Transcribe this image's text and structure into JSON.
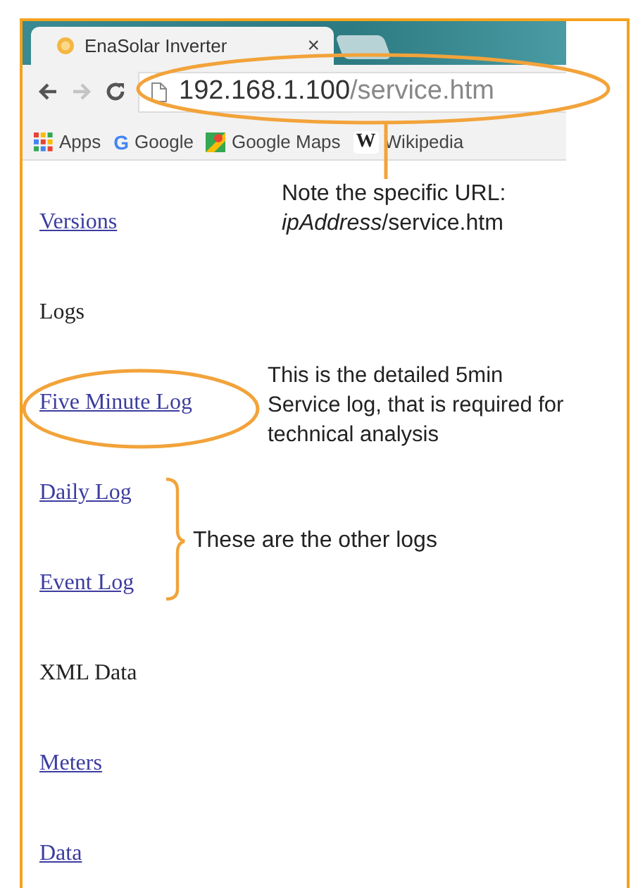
{
  "browser": {
    "tab": {
      "title": "EnaSolar Inverter",
      "close": "×"
    },
    "forward_disabled": true,
    "url": {
      "host": "192.168.1.100",
      "path": "/service.htm"
    },
    "bookmarks": [
      {
        "kind": "apps",
        "label": "Apps"
      },
      {
        "kind": "google",
        "glyph": "G",
        "label": "Google"
      },
      {
        "kind": "maps",
        "label": "Google Maps"
      },
      {
        "kind": "wiki",
        "glyph": "W",
        "label": "Wikipedia"
      }
    ]
  },
  "page": {
    "items": [
      {
        "kind": "link",
        "label": "Versions"
      },
      {
        "kind": "heading",
        "label": "Logs"
      },
      {
        "kind": "link",
        "label": "Five Minute Log"
      },
      {
        "kind": "link",
        "label": "Daily Log"
      },
      {
        "kind": "link",
        "label": "Event Log"
      },
      {
        "kind": "heading",
        "label": "XML Data"
      },
      {
        "kind": "link",
        "label": "Meters"
      },
      {
        "kind": "link",
        "label": "Data"
      }
    ]
  },
  "annotations": [
    {
      "kind": "url",
      "lines": [
        "Note the specific URL:",
        "*ipAddress*/service.htm"
      ]
    },
    {
      "kind": "five",
      "lines": [
        "This is the detailed 5min",
        "Service log, that is required for",
        "technical analysis"
      ]
    },
    {
      "kind": "brace",
      "lines": [
        "These are the other logs"
      ]
    }
  ]
}
